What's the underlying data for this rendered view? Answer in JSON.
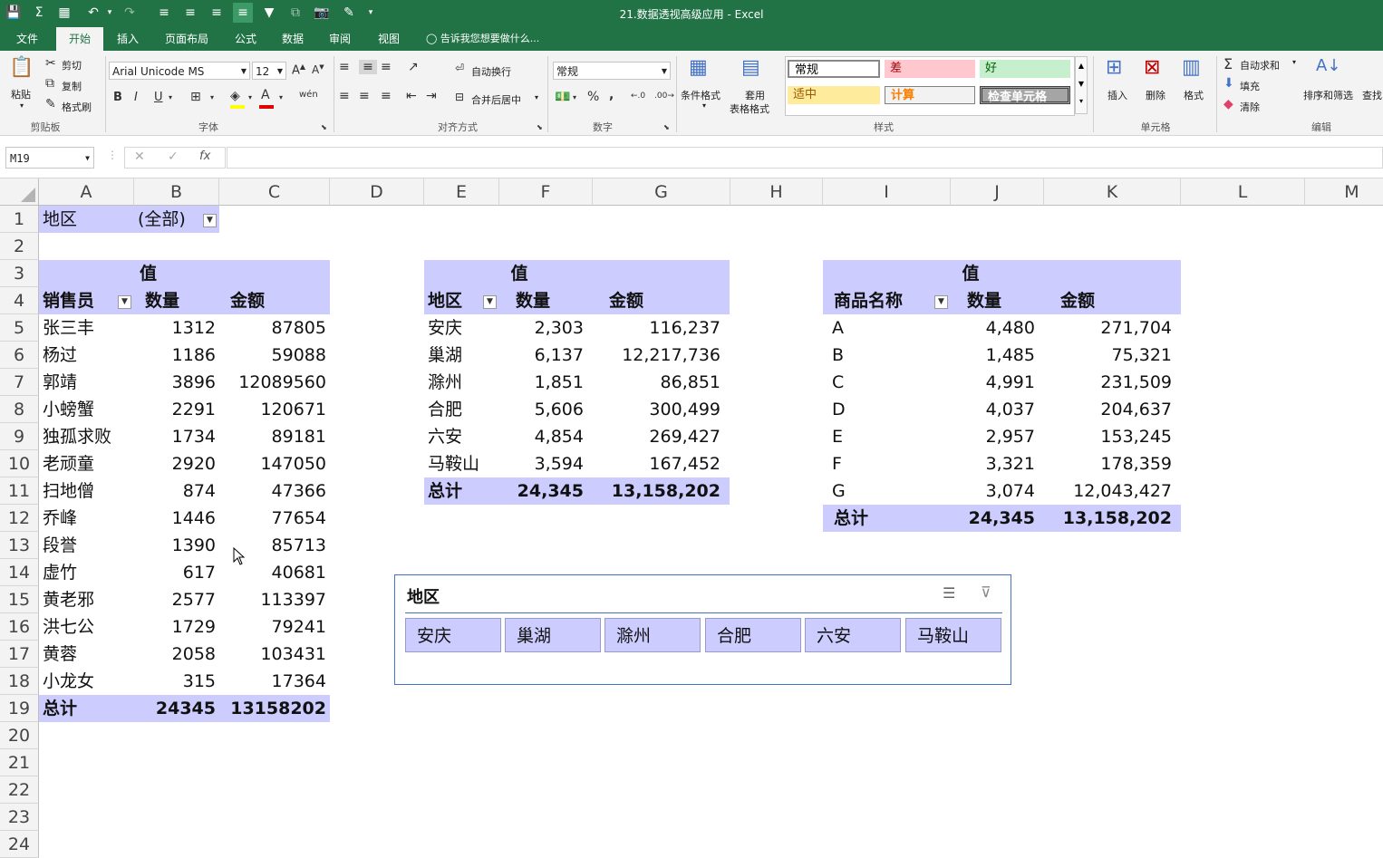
{
  "window": {
    "title": "21.数据透视高级应用 - Excel"
  },
  "tabs": [
    "文件",
    "开始",
    "插入",
    "页面布局",
    "公式",
    "数据",
    "审阅",
    "视图"
  ],
  "tell_me": "告诉我您想要做什么...",
  "ribbon": {
    "clipboard": {
      "paste": "粘贴",
      "cut": "剪切",
      "copy": "复制",
      "format_painter": "格式刷",
      "label": "剪贴板"
    },
    "font": {
      "name": "Arial Unicode MS",
      "size": "12",
      "label": "字体",
      "bold": "B",
      "italic": "I",
      "underline": "U"
    },
    "alignment": {
      "wrap": "自动换行",
      "merge": "合并后居中",
      "label": "对齐方式"
    },
    "number": {
      "format": "常规",
      "percent": "%",
      "comma": ",",
      "label": "数字"
    },
    "styles": {
      "conditional": "条件格式",
      "table_fmt_1": "套用",
      "table_fmt_2": "表格格式",
      "normal": "常规",
      "bad": "差",
      "good": "好",
      "neutral": "适中",
      "calc": "计算",
      "check": "检查单元格",
      "label": "样式"
    },
    "cells": {
      "insert": "插入",
      "delete": "删除",
      "format": "格式",
      "label": "单元格"
    },
    "editing": {
      "autosum": "自动求和",
      "fill": "填充",
      "clear": "清除",
      "sort": "排序和筛选",
      "find": "查找",
      "label": "编辑"
    }
  },
  "formula_bar": {
    "name_box": "M19",
    "cancel": "✕",
    "enter": "✓",
    "fx": "fx",
    "content": ""
  },
  "columns": [
    "A",
    "B",
    "C",
    "D",
    "E",
    "F",
    "G",
    "H",
    "I",
    "J",
    "K",
    "L",
    "M"
  ],
  "rows": [
    "1",
    "2",
    "3",
    "4",
    "5",
    "6",
    "7",
    "8",
    "9",
    "10",
    "11",
    "12",
    "13",
    "14",
    "15",
    "16",
    "17",
    "18",
    "19",
    "20",
    "21",
    "22",
    "23",
    "24"
  ],
  "pivot1": {
    "filter_label": "地区",
    "filter_value": "(全部)",
    "values_header": "值",
    "headers": [
      "销售员",
      "数量",
      "金额"
    ],
    "rows": [
      [
        "张三丰",
        "1312",
        "87805"
      ],
      [
        "杨过",
        "1186",
        "59088"
      ],
      [
        "郭靖",
        "3896",
        "12089560"
      ],
      [
        "小螃蟹",
        "2291",
        "120671"
      ],
      [
        "独孤求败",
        "1734",
        "89181"
      ],
      [
        "老顽童",
        "2920",
        "147050"
      ],
      [
        "扫地僧",
        "874",
        "47366"
      ],
      [
        "乔峰",
        "1446",
        "77654"
      ],
      [
        "段誉",
        "1390",
        "85713"
      ],
      [
        "虚竹",
        "617",
        "40681"
      ],
      [
        "黄老邪",
        "2577",
        "113397"
      ],
      [
        "洪七公",
        "1729",
        "79241"
      ],
      [
        "黄蓉",
        "2058",
        "103431"
      ],
      [
        "小龙女",
        "315",
        "17364"
      ]
    ],
    "total": [
      "总计",
      "24345",
      "13158202"
    ]
  },
  "pivot2": {
    "values_header": "值",
    "headers": [
      "地区",
      "数量",
      "金额"
    ],
    "rows": [
      [
        "安庆",
        "2,303",
        "116,237"
      ],
      [
        "巢湖",
        "6,137",
        "12,217,736"
      ],
      [
        "滁州",
        "1,851",
        "86,851"
      ],
      [
        "合肥",
        "5,606",
        "300,499"
      ],
      [
        "六安",
        "4,854",
        "269,427"
      ],
      [
        "马鞍山",
        "3,594",
        "167,452"
      ]
    ],
    "total": [
      "总计",
      "24,345",
      "13,158,202"
    ]
  },
  "pivot3": {
    "values_header": "值",
    "headers": [
      "商品名称",
      "数量",
      "金额"
    ],
    "rows": [
      [
        "A",
        "4,480",
        "271,704"
      ],
      [
        "B",
        "1,485",
        "75,321"
      ],
      [
        "C",
        "4,991",
        "231,509"
      ],
      [
        "D",
        "4,037",
        "204,637"
      ],
      [
        "E",
        "2,957",
        "153,245"
      ],
      [
        "F",
        "3,321",
        "178,359"
      ],
      [
        "G",
        "3,074",
        "12,043,427"
      ]
    ],
    "total": [
      "总计",
      "24,345",
      "13,158,202"
    ]
  },
  "slicer": {
    "title": "地区",
    "items": [
      "安庆",
      "巢湖",
      "滁州",
      "合肥",
      "六安",
      "马鞍山"
    ]
  },
  "colors": {
    "excel_green": "#217346",
    "pivot_band": "#ccccff",
    "slicer_border": "#4472c4"
  }
}
